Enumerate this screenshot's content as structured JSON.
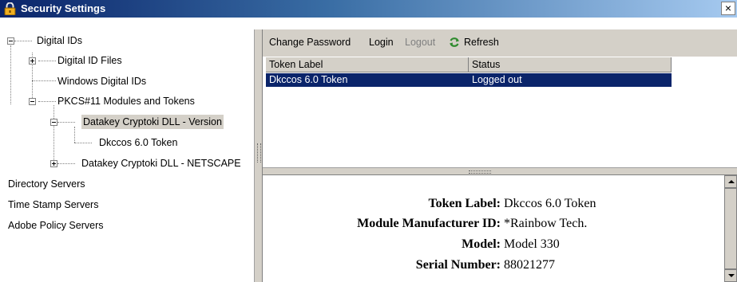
{
  "window": {
    "title": "Security Settings",
    "close_label": "×",
    "icon": "padlock-icon"
  },
  "tree": {
    "items": [
      {
        "label": "Digital IDs",
        "expander": "minus"
      },
      {
        "label": "Digital ID Files",
        "expander": "plus"
      },
      {
        "label": "Windows Digital IDs",
        "expander": "none"
      },
      {
        "label": "PKCS#11 Modules and Tokens",
        "expander": "minus"
      },
      {
        "label": "Datakey Cryptoki DLL - Version",
        "expander": "minus",
        "selected": true
      },
      {
        "label": "Dkccos 6.0 Token",
        "expander": "none"
      },
      {
        "label": "Datakey Cryptoki DLL - NETSCAPE",
        "expander": "plus"
      },
      {
        "label": "Directory Servers",
        "expander": "none"
      },
      {
        "label": "Time Stamp Servers",
        "expander": "none"
      },
      {
        "label": "Adobe Policy Servers",
        "expander": "none"
      }
    ]
  },
  "toolbar": {
    "change_password": "Change Password",
    "login": "Login",
    "logout": "Logout",
    "refresh": "Refresh",
    "refresh_icon": "refresh-icon"
  },
  "table": {
    "columns": [
      "Token Label",
      "Status"
    ],
    "rows": [
      {
        "token_label": "Dkccos 6.0 Token",
        "status": "Logged out",
        "selected": true
      }
    ]
  },
  "details": {
    "rows": [
      {
        "label": "Token Label:",
        "value": "Dkccos 6.0 Token"
      },
      {
        "label": "Module Manufacturer ID:",
        "value": "*Rainbow Tech."
      },
      {
        "label": "Model:",
        "value": "Model 330"
      },
      {
        "label": "Serial Number:",
        "value": "88021277"
      }
    ]
  },
  "colors": {
    "title_bar_start": "#0a246a",
    "title_bar_end": "#a6caf0",
    "selection": "#0a246a",
    "panel": "#d4d0c8",
    "refresh_green": "#2e8b2e"
  }
}
